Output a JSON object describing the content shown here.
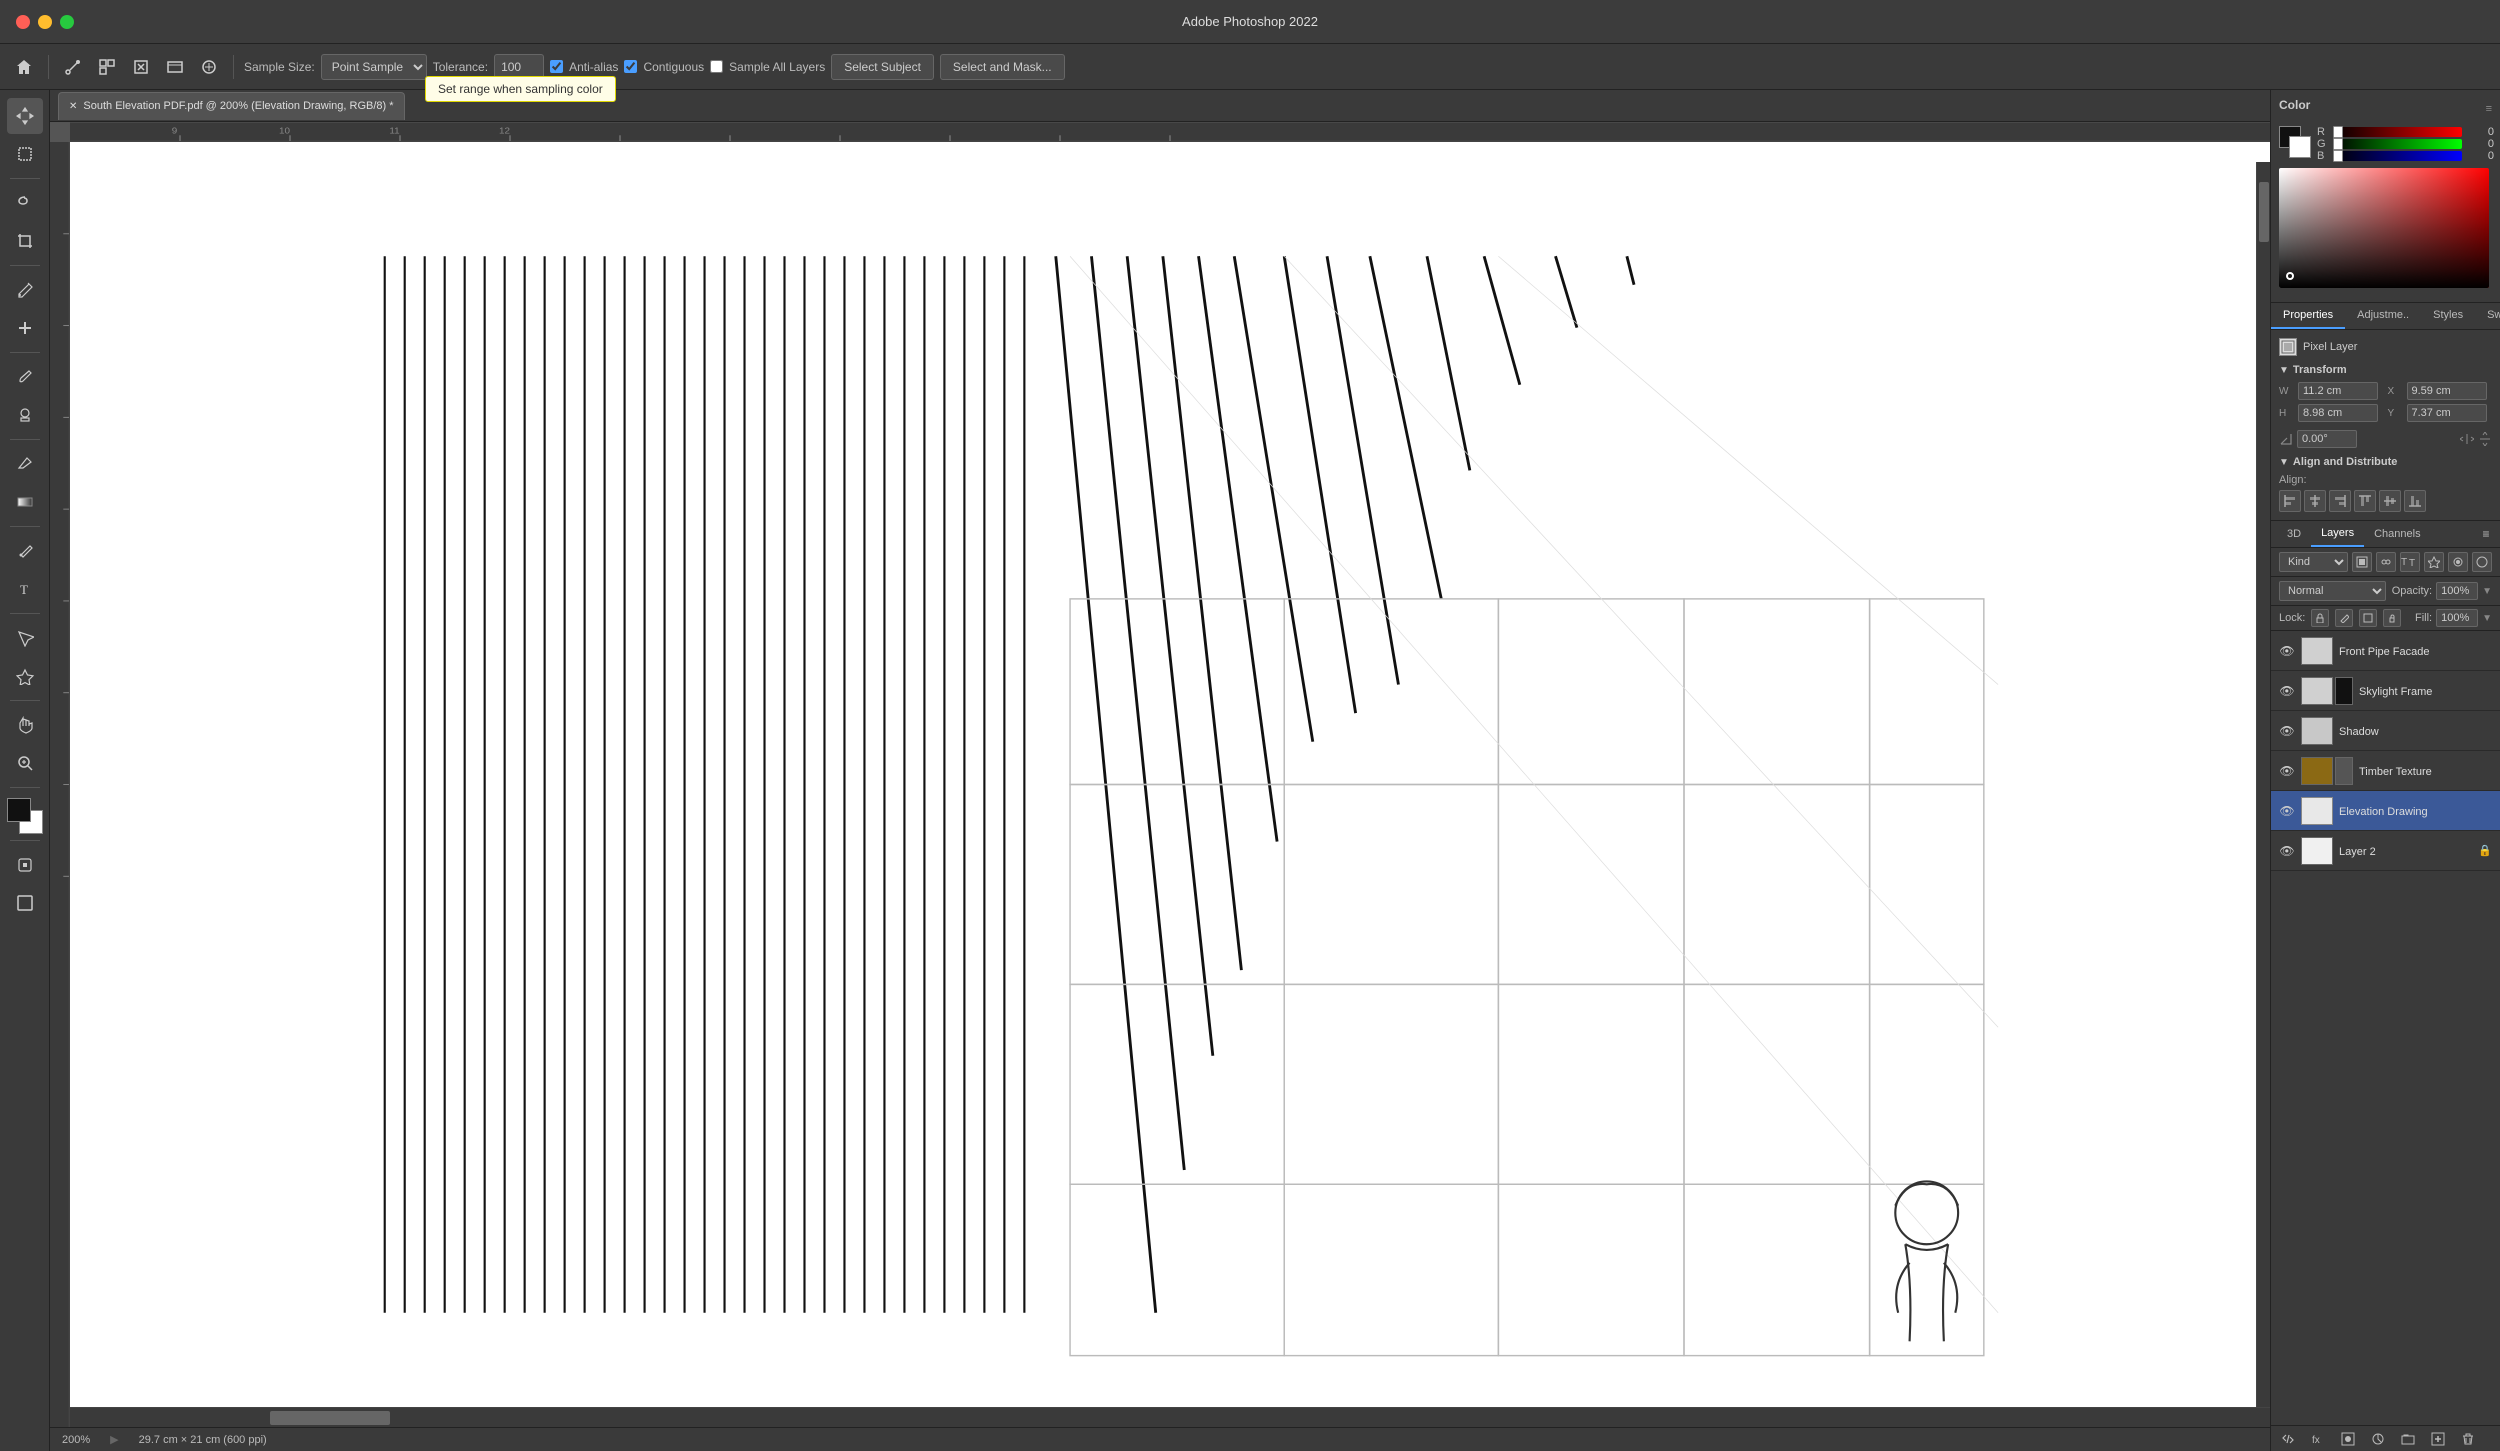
{
  "app": {
    "title": "Adobe Photoshop 2022"
  },
  "titlebar": {
    "title": "Adobe Photoshop 2022"
  },
  "toolbar": {
    "sample_size_label": "Sample Size:",
    "sample_size_value": "Point Sample",
    "tolerance_label": "Tolerance:",
    "tolerance_value": "100",
    "anti_alias_label": "Anti-alias",
    "contiguous_label": "Contiguous",
    "sample_all_layers_label": "Sample All Layers",
    "select_subject_label": "Select Subject",
    "select_and_mask_label": "Select and Mask..."
  },
  "tooltip": {
    "text": "Set range when sampling color"
  },
  "tab": {
    "filename": "South Elevation PDF.pdf @ 200% (Elevation Drawing, RGB/8) *"
  },
  "color_panel": {
    "title": "Color",
    "r_value": "0",
    "g_value": "0",
    "b_value": "0"
  },
  "swatches_panel": {
    "title": "Swatches"
  },
  "properties_tabs": [
    {
      "label": "Properties",
      "id": "properties"
    },
    {
      "label": "Adjustme..",
      "id": "adjustments"
    },
    {
      "label": "Styles",
      "id": "styles"
    },
    {
      "label": "Swatches",
      "id": "swatches"
    }
  ],
  "pixel_layer": {
    "label": "Pixel Layer"
  },
  "transform": {
    "title": "Transform",
    "w_label": "W",
    "w_value": "11.2 cm",
    "x_label": "X",
    "x_value": "9.59 cm",
    "h_label": "H",
    "h_value": "8.98 cm",
    "y_label": "Y",
    "y_value": "7.37 cm",
    "angle_value": "0.00°"
  },
  "align_distribute": {
    "title": "Align and Distribute",
    "align_label": "Align:"
  },
  "layers": {
    "panel_title": "Layers",
    "channels_tab": "Channels",
    "three_d_tab": "3D",
    "kind_label": "Kind",
    "blend_mode": "Normal",
    "opacity_label": "Opacity:",
    "opacity_value": "100%",
    "lock_label": "Lock:",
    "fill_label": "Fill:",
    "fill_value": "100%",
    "items": [
      {
        "name": "Front Pipe Facade",
        "visible": true,
        "locked": false,
        "has_mask": false,
        "thumb_color": "#d0d0d0"
      },
      {
        "name": "Skylight Frame",
        "visible": true,
        "locked": false,
        "has_mask": true,
        "thumb_color": "#111111"
      },
      {
        "name": "Shadow",
        "visible": true,
        "locked": false,
        "has_mask": false,
        "thumb_color": "#c8c8c8"
      },
      {
        "name": "Timber Texture",
        "visible": true,
        "locked": false,
        "has_mask": true,
        "thumb_color": "#8B6914"
      },
      {
        "name": "Elevation Drawing",
        "visible": true,
        "locked": false,
        "has_mask": false,
        "thumb_color": "#e8e8e8",
        "active": true
      },
      {
        "name": "Layer 2",
        "visible": true,
        "locked": true,
        "has_mask": false,
        "thumb_color": "#f0f0f0"
      }
    ]
  },
  "status_bar": {
    "zoom": "200%",
    "dimensions": "29.7 cm × 21 cm (600 ppi)"
  },
  "swatches_colors": [
    "#ff0000",
    "#ff4400",
    "#ff8800",
    "#ffcc00",
    "#ffff00",
    "#88ff00",
    "#00ff00",
    "#00ff88",
    "#00ffff",
    "#0088ff",
    "#0000ff",
    "#8800ff",
    "#ff00ff",
    "#ff0088",
    "#ffffff",
    "#cccccc",
    "#888888",
    "#444444",
    "#000000",
    "#8B4513",
    "#d2691e",
    "#f4a460",
    "#ffe4b5",
    "#ffefd5",
    "#ff6347",
    "#ff7f50",
    "#ffa07a",
    "#e9967a",
    "#fa8072",
    "#dc143c",
    "#b22222",
    "#8b0000"
  ]
}
